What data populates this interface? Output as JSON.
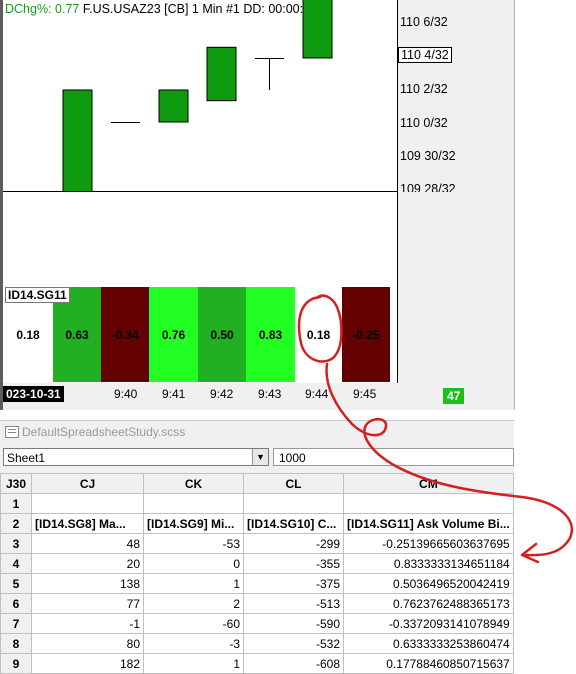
{
  "chart": {
    "header": {
      "dchg": "DChg%: 0.77",
      "symbol_info": "F.US.USAZ23 [CB]  1 Min   #1 DD: 00:00:01"
    },
    "y_ticks": [
      "110 6/32",
      "110 4/32",
      "110 2/32",
      "110 0/32",
      "109 30/32",
      "109 28/32"
    ],
    "current_price_label": "110 4/32",
    "candles": [
      {
        "open": 109.59,
        "close": 109.59,
        "high": 109.59,
        "low": 109.59,
        "color": "#000000"
      },
      {
        "open": 109.59,
        "close": 110.03,
        "high": 110.03,
        "low": 109.59,
        "color": "#109a10"
      },
      {
        "open": 110.0,
        "close": 110.0,
        "high": 110.0,
        "low": 110.0,
        "color": "#000000"
      },
      {
        "open": 110.0,
        "close": 110.03,
        "high": 110.03,
        "low": 110.0,
        "color": "#109a10"
      },
      {
        "open": 110.02,
        "close": 110.07,
        "high": 110.07,
        "low": 110.02,
        "color": "#109a10"
      },
      {
        "open": 110.06,
        "close": 110.06,
        "high": 110.06,
        "low": 110.03,
        "color": "#000000"
      },
      {
        "open": 110.06,
        "close": 110.14,
        "high": 110.14,
        "low": 110.06,
        "color": "#109a10"
      },
      {
        "open": 110.15,
        "close": 110.15,
        "high": 110.15,
        "low": 110.15,
        "color": "#000000"
      }
    ],
    "study_label": "ID14.SG11",
    "study_cells": [
      {
        "value": "0.18",
        "bg": "#ffffff"
      },
      {
        "value": "0.63",
        "bg": "#22b022"
      },
      {
        "value": "-0.34",
        "bg": "#650000"
      },
      {
        "value": "0.76",
        "bg": "#22ff22"
      },
      {
        "value": "0.50",
        "bg": "#22b022"
      },
      {
        "value": "0.83",
        "bg": "#22ff22"
      },
      {
        "value": "0.18",
        "bg": "#ffffff"
      },
      {
        "value": "-0.25",
        "bg": "#650000"
      }
    ],
    "date_label": "023-10-31",
    "x_labels": [
      "9:40",
      "9:41",
      "9:42",
      "9:43",
      "9:44",
      "9:45"
    ],
    "count_badge": "47"
  },
  "spreadsheet": {
    "title": "DefaultSpreadsheetStudy.scss",
    "sheet_selector": "Sheet1",
    "cell_value": "1000",
    "corner_label": "J30",
    "columns": [
      "CJ",
      "CK",
      "CL",
      "CM"
    ],
    "rows": [
      {
        "row": "1",
        "cells": [
          "",
          "",
          "",
          ""
        ]
      },
      {
        "row": "2",
        "cells": [
          "[ID14.SG8] Ma...",
          "[ID14.SG9] Mi...",
          "[ID14.SG10] C...",
          "[ID14.SG11] Ask Volume Bi..."
        ]
      },
      {
        "row": "3",
        "cells": [
          "48",
          "-53",
          "-299",
          "-0.25139665603637695"
        ]
      },
      {
        "row": "4",
        "cells": [
          "20",
          "0",
          "-355",
          "0.8333333134651184"
        ]
      },
      {
        "row": "5",
        "cells": [
          "138",
          "1",
          "-375",
          "0.5036496520042419"
        ]
      },
      {
        "row": "6",
        "cells": [
          "77",
          "2",
          "-513",
          "0.7623762488365173"
        ]
      },
      {
        "row": "7",
        "cells": [
          "-1",
          "-60",
          "-590",
          "-0.3372093141078949"
        ]
      },
      {
        "row": "8",
        "cells": [
          "80",
          "-3",
          "-532",
          "0.6333333253860474"
        ]
      },
      {
        "row": "9",
        "cells": [
          "182",
          "1",
          "-608",
          "0.17788460850715637"
        ]
      }
    ]
  },
  "annotation_color": "#d42020"
}
